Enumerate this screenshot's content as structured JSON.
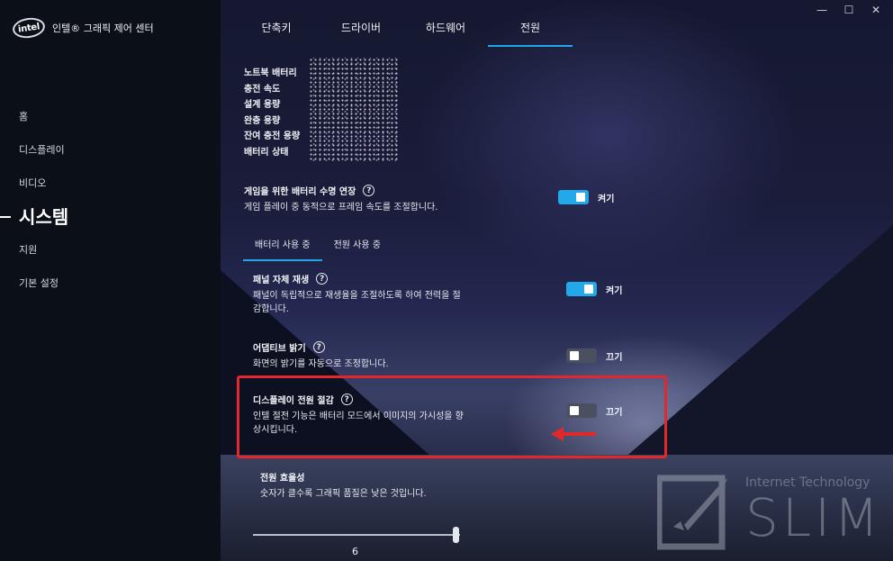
{
  "app": {
    "logo_text": "intel",
    "title": "인텔® 그래픽 제어 센터"
  },
  "window_controls": {
    "minimize": "—",
    "maximize": "☐",
    "close": "✕"
  },
  "sidebar": {
    "items": [
      {
        "label": "홈"
      },
      {
        "label": "디스플레이"
      },
      {
        "label": "비디오"
      },
      {
        "label": "시스템"
      },
      {
        "label": "지원"
      },
      {
        "label": "기본 설정"
      }
    ],
    "active": "시스템"
  },
  "tabs": [
    {
      "label": "단축키"
    },
    {
      "label": "드라이버"
    },
    {
      "label": "하드웨어"
    },
    {
      "label": "전원"
    }
  ],
  "active_tab": "전원",
  "battery_info": {
    "rows": [
      "노트북 배터리",
      "충전 속도",
      "설계 용량",
      "완충 용량",
      "잔여 충전 용량",
      "배터리 상태"
    ]
  },
  "game_battery": {
    "title": "게임을 위한 배터리 수명 연장",
    "desc": "게임 플레이 중 동적으로 프레임 속도를 조절합니다.",
    "state_label": "켜기",
    "on": true
  },
  "subtabs": [
    {
      "label": "배터리 사용 중"
    },
    {
      "label": "전원 사용 중"
    }
  ],
  "panel_self_refresh": {
    "title": "패널 자체 재생",
    "desc_line1": "패널이 독립적으로 재생율을 조절하도록 하여 전력을 절",
    "desc_line2": "감합니다.",
    "state_label": "켜기",
    "on": true
  },
  "adaptive_brightness": {
    "title": "어댑티브 밝기",
    "desc": "화면의 밝기를 자동으로 조정합니다.",
    "state_label": "끄기",
    "on": false
  },
  "display_power_saving": {
    "title": "디스플레이 전원 절감",
    "desc_line1": "인텔 절전 기능은 배터리 모드에서 이미지의 가시성을 향",
    "desc_line2": "상시킵니다.",
    "state_label": "끄기",
    "on": false
  },
  "power_efficiency": {
    "title": "전원 효율성",
    "desc": "숫자가 클수록 그래픽 품질은 낮은 것입니다.",
    "value": "6"
  },
  "watermark": {
    "small": "Internet Technology",
    "big": "SLIM"
  },
  "colors": {
    "accent": "#23a8ea",
    "highlight": "#e3282c"
  }
}
